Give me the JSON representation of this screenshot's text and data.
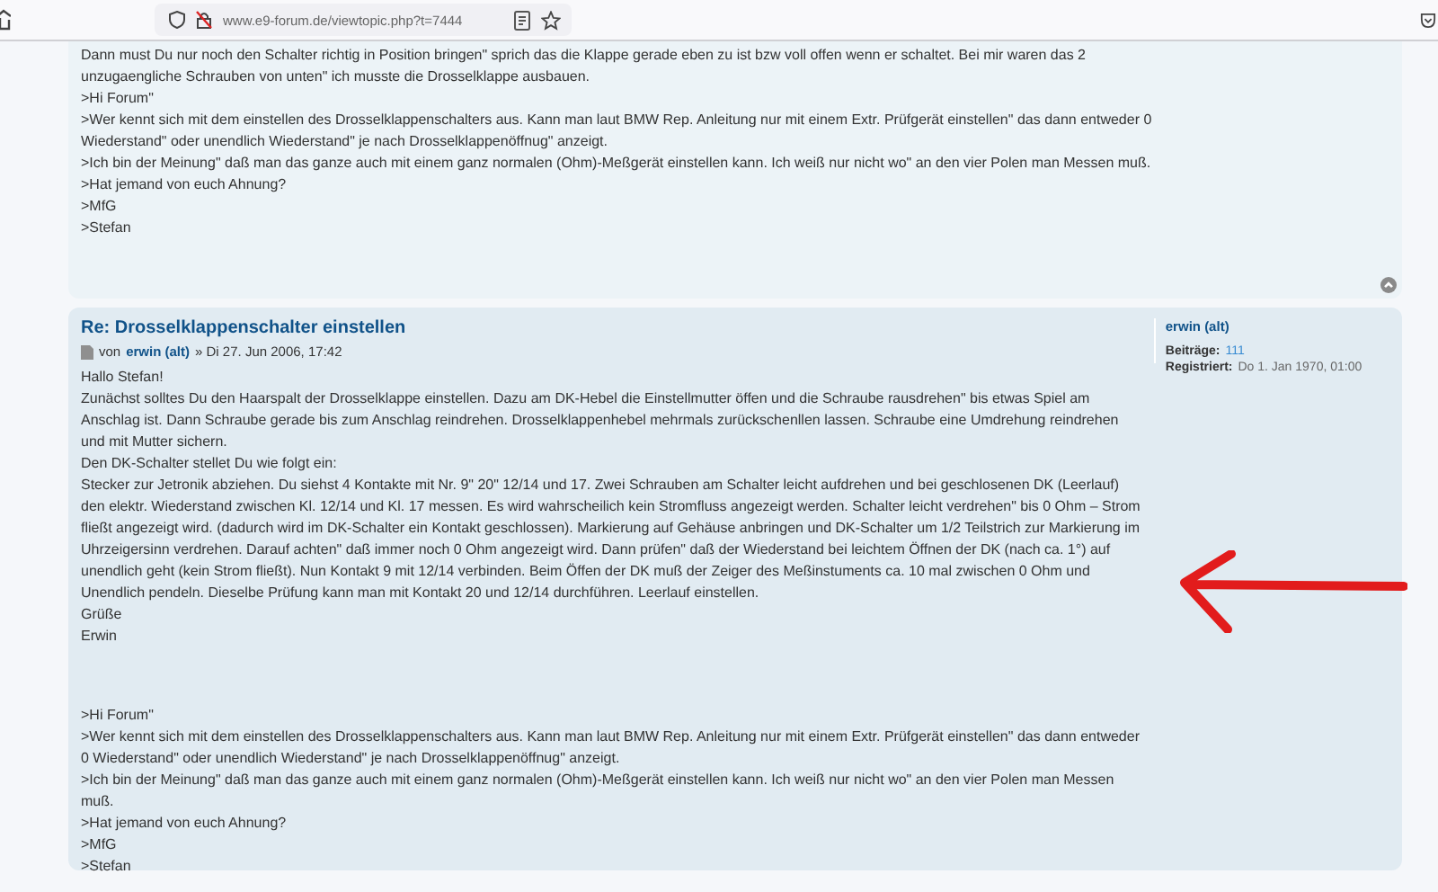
{
  "browser": {
    "url": "www.e9-forum.de/viewtopic.php?t=7444"
  },
  "posts": [
    {
      "paragraphs": [
        "Dann must Du nur noch den Schalter richtig in Position bringen\" sprich das die Klappe gerade eben zu ist bzw voll offen wenn er schaltet. Bei mir waren das 2 unzugaengliche Schrauben von unten\" ich musste die Drosselklappe ausbauen.",
        ">Hi Forum\"",
        ">Wer kennt sich mit dem einstellen des Drosselklappenschalters aus. Kann man laut BMW Rep. Anleitung nur mit einem Extr. Prüfgerät einstellen\" das dann entweder 0 Wiederstand\" oder unendlich Wiederstand\" je nach Drosselklappenöffnug\" anzeigt.",
        ">Ich bin der Meinung\" daß man das ganze auch mit einem ganz normalen (Ohm)-Meßgerät einstellen kann. Ich weiß nur nicht wo\" an den vier Polen man Messen muß.",
        ">Hat jemand von euch Ahnung?",
        ">MfG",
        ">Stefan"
      ]
    },
    {
      "title": "Re: Drosselklappenschalter einstellen",
      "meta": {
        "prefix": "von",
        "author": "erwin (alt)",
        "date": "» Di 27. Jun 2006, 17:42"
      },
      "paragraphs": [
        "Hallo Stefan!",
        "Zunächst solltes Du den Haarspalt der Drosselklappe einstellen. Dazu am DK-Hebel die Einstellmutter öffen und die Schraube rausdrehen\" bis etwas Spiel am Anschlag ist. Dann Schraube gerade bis zum Anschlag reindrehen. Drosselklappenhebel mehrmals zurückschenllen lassen. Schraube eine Umdrehung reindrehen und mit Mutter sichern.",
        "Den DK-Schalter stellet Du wie folgt ein:",
        "Stecker zur Jetronik abziehen. Du siehst 4 Kontakte mit Nr. 9\" 20\" 12/14 und 17. Zwei Schrauben am Schalter leicht aufdrehen und bei geschlosenen DK (Leerlauf) den elektr. Wiederstand zwischen Kl. 12/14 und Kl. 17 messen. Es wird wahrscheilich kein Stromfluss angezeigt werden. Schalter leicht verdrehen\" bis 0 Ohm – Strom fließt angezeigt wird. (dadurch wird im DK-Schalter ein Kontakt geschlossen). Markierung auf Gehäuse anbringen und DK-Schalter um 1/2 Teilstrich zur Markierung im Uhrzeigersinn verdrehen. Darauf achten\" daß immer noch 0 Ohm angezeigt wird. Dann prüfen\" daß der Wiederstand bei leichtem Öffnen der DK (nach ca. 1°) auf unendlich geht (kein Strom fließt). Nun Kontakt 9 mit 12/14 verbinden. Beim Öffen der DK muß der Zeiger des Meßinstuments ca. 10 mal zwischen 0 Ohm und Unendlich pendeln. Dieselbe Prüfung kann man mit Kontakt 20 und 12/14 durchführen. Leerlauf einstellen.",
        "Grüße",
        "Erwin"
      ],
      "quoted_paragraphs": [
        ">Hi Forum\"",
        ">Wer kennt sich mit dem einstellen des Drosselklappenschalters aus. Kann man laut BMW Rep. Anleitung nur mit einem Extr. Prüfgerät einstellen\" das dann entweder 0 Wiederstand\" oder unendlich Wiederstand\" je nach Drosselklappenöffnug\" anzeigt.",
        ">Ich bin der Meinung\" daß man das ganze auch mit einem ganz normalen (Ohm)-Meßgerät einstellen kann. Ich weiß nur nicht wo\" an den vier Polen man Messen muß.",
        ">Hat jemand von euch Ahnung?",
        ">MfG",
        ">Stefan"
      ],
      "profile": {
        "name": "erwin (alt)",
        "posts_label": "Beiträge:",
        "posts": "111",
        "registered_label": "Registriert:",
        "registered": "Do 1. Jan 1970, 01:00"
      }
    }
  ]
}
